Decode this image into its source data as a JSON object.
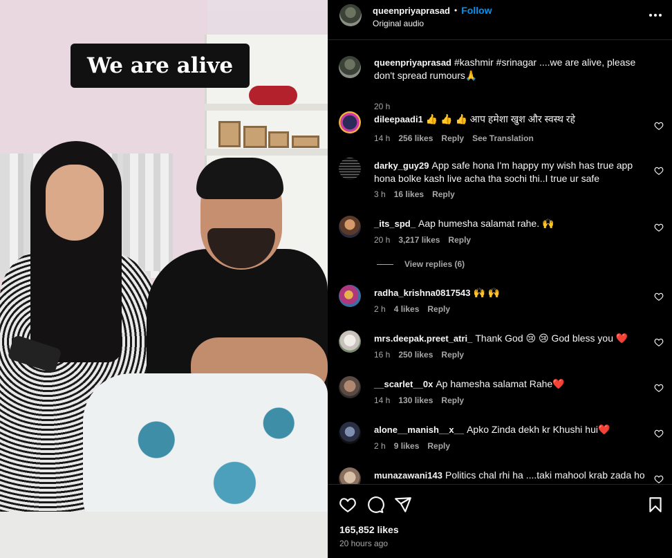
{
  "video": {
    "caption": "We are alive"
  },
  "post": {
    "author": "queenpriyaprasad",
    "separator": "•",
    "follow_label": "Follow",
    "audio": "Original audio",
    "caption_text": "#kashmir #srinagar ....we are alive, please don't spread rumours🙏",
    "caption_time": "20 h"
  },
  "comments": [
    {
      "user": "dileepaadi1",
      "text": "👍 👍 👍 आप हमेशा खुश और स्वस्थ रहे",
      "time": "14 h",
      "likes": "256 likes",
      "reply": "Reply",
      "extra": "See Translation"
    },
    {
      "user": "darky_guy29",
      "text": "App safe hona I'm happy my wish has true app hona bolke kash live acha tha sochi thi..I true ur safe",
      "time": "3 h",
      "likes": "16 likes",
      "reply": "Reply"
    },
    {
      "user": "_its_spd_",
      "text": "Aap humesha salamat rahe. 🙌",
      "time": "20 h",
      "likes": "3,217 likes",
      "reply": "Reply",
      "view_replies": "View replies (6)"
    },
    {
      "user": "radha_krishna0817543",
      "text": "🙌 🙌",
      "time": "2 h",
      "likes": "4 likes",
      "reply": "Reply"
    },
    {
      "user": "mrs.deepak.preet_atri_",
      "text": "Thank God 😢 😢  God bless you ❤️",
      "time": "16 h",
      "likes": "250 likes",
      "reply": "Reply"
    },
    {
      "user": "__scarlet__0x",
      "text": "Ap hamesha salamat Rahe❤️",
      "time": "14 h",
      "likes": "130 likes",
      "reply": "Reply"
    },
    {
      "user": "alone__manish__x__",
      "text": "Apko Zinda dekh kr Khushi hui❤️",
      "time": "2 h",
      "likes": "9 likes",
      "reply": "Reply"
    },
    {
      "user": "munazawani143",
      "text": "Politics chal rhi ha ....taki mahool krab zada ho",
      "time": "",
      "likes": "",
      "reply": ""
    }
  ],
  "footer": {
    "likes": "165,852 likes",
    "ago": "20 hours ago"
  },
  "icons": [
    "heart-icon",
    "comment-icon",
    "share-icon",
    "bookmark-icon",
    "more-icon"
  ],
  "colors": {
    "link": "#0095f6",
    "muted": "#a8a8a8",
    "background": "#000000"
  }
}
